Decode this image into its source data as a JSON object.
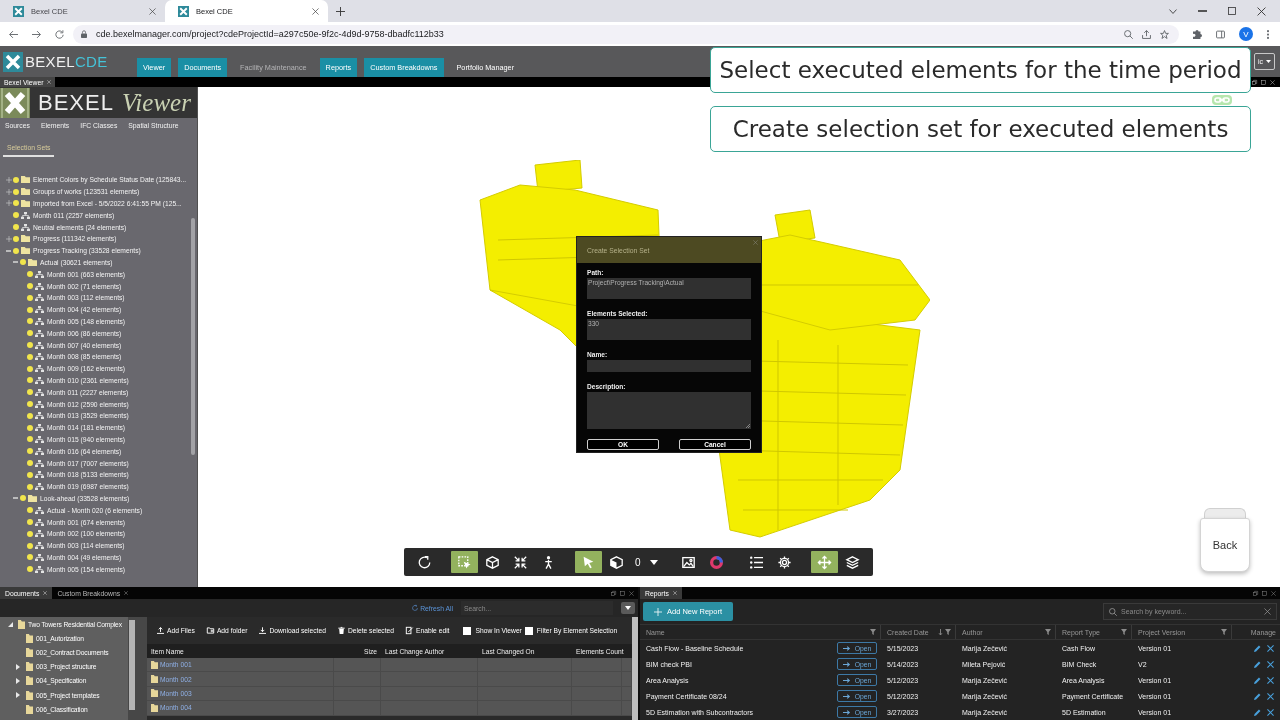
{
  "browser": {
    "tabs": [
      {
        "title": "Bexel CDE",
        "selected": false
      },
      {
        "title": "Bexel CDE",
        "selected": true
      }
    ],
    "url": "cde.bexelmanager.com/project?cdeProjectId=a297c50e-9f2c-4d9d-9758-dbadfc112b33",
    "profile": "V"
  },
  "app_header": {
    "logo": {
      "brand": "BEXEL",
      "product": "CDE"
    },
    "nav": [
      {
        "label": "Viewer",
        "open": true,
        "disabled": false
      },
      {
        "label": "Documents",
        "open": true,
        "disabled": false
      },
      {
        "label": "Facility Maintenance",
        "open": false,
        "disabled": true
      },
      {
        "label": "Reports",
        "open": true,
        "disabled": false
      },
      {
        "label": "Custom Breakdowns",
        "open": true,
        "disabled": false
      },
      {
        "label": "Portfolio Manager",
        "open": false,
        "disabled": false
      }
    ],
    "dropdown": "ic"
  },
  "viewer_panel": {
    "tab": "Bexel Viewer",
    "sidebar": {
      "logo": {
        "brand": "BEXEL",
        "product": "Viewer"
      },
      "tabs": [
        {
          "label": "Sources",
          "selected": false
        },
        {
          "label": "Elements",
          "selected": false
        },
        {
          "label": "IFC Classes",
          "selected": false
        },
        {
          "label": "Spatial Structure",
          "selected": false
        },
        {
          "label": "Selection Sets",
          "selected": true
        }
      ],
      "tree": [
        {
          "label": "Element Colors by Schedule Status Date (125843...",
          "kind": "folder",
          "expanded": false
        },
        {
          "label": "Groups of works (123531 elements)",
          "kind": "folder",
          "expanded": false
        },
        {
          "label": "Imported from Excel - 5/5/2022 6:41:55 PM (125...",
          "kind": "folder",
          "expanded": false
        },
        {
          "label": "Month 011 (2257 elements)",
          "kind": "set"
        },
        {
          "label": "Neutral elements (24 elements)",
          "kind": "set"
        },
        {
          "label": "Progress (111342 elements)",
          "kind": "folder",
          "expanded": false
        },
        {
          "label": "Progress Tracking (33528 elements)",
          "kind": "folder",
          "expanded": true,
          "children": [
            {
              "label": "Actual (30621 elements)",
              "kind": "folder",
              "expanded": true,
              "children": [
                {
                  "label": "Month 001 (663 elements)",
                  "kind": "set"
                },
                {
                  "label": "Month 002 (71 elements)",
                  "kind": "set"
                },
                {
                  "label": "Month 003 (112 elements)",
                  "kind": "set"
                },
                {
                  "label": "Month 004 (42 elements)",
                  "kind": "set"
                },
                {
                  "label": "Month 005 (148 elements)",
                  "kind": "set"
                },
                {
                  "label": "Month 006 (86 elements)",
                  "kind": "set"
                },
                {
                  "label": "Month 007 (40 elements)",
                  "kind": "set"
                },
                {
                  "label": "Month 008 (85 elements)",
                  "kind": "set"
                },
                {
                  "label": "Month 009 (162 elements)",
                  "kind": "set"
                },
                {
                  "label": "Month 010 (2361 elements)",
                  "kind": "set"
                },
                {
                  "label": "Month 011 (2227 elements)",
                  "kind": "set"
                },
                {
                  "label": "Month 012 (2590 elements)",
                  "kind": "set"
                },
                {
                  "label": "Month 013 (3529 elements)",
                  "kind": "set"
                },
                {
                  "label": "Month 014 (181 elements)",
                  "kind": "set"
                },
                {
                  "label": "Month 015 (940 elements)",
                  "kind": "set"
                },
                {
                  "label": "Month 016 (64 elements)",
                  "kind": "set"
                },
                {
                  "label": "Month 017 (7007 elements)",
                  "kind": "set"
                },
                {
                  "label": "Month 018 (5133 elements)",
                  "kind": "set"
                },
                {
                  "label": "Month 019 (6987 elements)",
                  "kind": "set"
                }
              ]
            },
            {
              "label": "Look-ahead (33528 elements)",
              "kind": "folder",
              "expanded": true,
              "children": [
                {
                  "label": "Actual - Month 020 (6 elements)",
                  "kind": "set"
                },
                {
                  "label": "Month 001 (674 elements)",
                  "kind": "set"
                },
                {
                  "label": "Month 002 (100 elements)",
                  "kind": "set"
                },
                {
                  "label": "Month 003 (114 elements)",
                  "kind": "set"
                },
                {
                  "label": "Month 004 (49 elements)",
                  "kind": "set"
                },
                {
                  "label": "Month 005 (154 elements)",
                  "kind": "set"
                }
              ]
            }
          ]
        }
      ]
    },
    "toolbar": {
      "groups": [
        [
          {
            "kind": "button",
            "selected": false
          }
        ],
        [
          {
            "kind": "button",
            "selected": true
          },
          {
            "kind": "button",
            "selected": false
          },
          {
            "kind": "button",
            "selected": false
          },
          {
            "kind": "button",
            "selected": false
          }
        ],
        [
          {
            "kind": "button",
            "selected": true
          },
          {
            "kind": "button",
            "selected": false
          },
          {
            "kind": "counter",
            "value": "0"
          }
        ],
        [
          {
            "kind": "button",
            "selected": false
          },
          {
            "kind": "button",
            "selected": false
          }
        ],
        [
          {
            "kind": "button",
            "selected": false
          },
          {
            "kind": "button",
            "selected": false
          }
        ],
        [
          {
            "kind": "button",
            "selected": true
          },
          {
            "kind": "button",
            "selected": false
          }
        ]
      ]
    },
    "nav_cube": {
      "face": "Back"
    },
    "dialog": {
      "title": "Create Selection Set",
      "fields": [
        {
          "label": "Path:",
          "kind": "readonly",
          "value": "Project\\Progress Tracking\\Actual"
        },
        {
          "label": "Elements Selected:",
          "kind": "readonly",
          "value": "330"
        },
        {
          "label": "Name:",
          "kind": "input"
        },
        {
          "label": "Description:",
          "kind": "textarea"
        }
      ],
      "buttons": [
        "OK",
        "Cancel"
      ]
    }
  },
  "callouts": [
    "Select executed elements for the time period",
    "Create selection set for executed elements"
  ],
  "documents_panel": {
    "tabs": [
      {
        "label": "Documents",
        "selected": true
      },
      {
        "label": "Custom Breakdowns",
        "selected": false
      }
    ],
    "refresh": "Refresh All",
    "search": {
      "placeholder": "Search..."
    },
    "folders": [
      {
        "label": "Two Towers Residential Complex",
        "expanded": true,
        "children": [
          {
            "label": "001_Autorization"
          },
          {
            "label": "002_Contract Documents"
          },
          {
            "label": "003_Project structure",
            "expanded": false
          },
          {
            "label": "004_Specification",
            "expanded": false
          },
          {
            "label": "005_Project templates",
            "expanded": false
          },
          {
            "label": "006_Classification"
          }
        ]
      }
    ],
    "actions": [
      "Add Files",
      "Add folder",
      "Download selected",
      "Delete selected",
      "Enable edit"
    ],
    "checkboxes": [
      {
        "label": "Show In Viewer",
        "checked": false
      },
      {
        "label": "Filter By Element Selection",
        "checked": false
      }
    ],
    "columns": [
      "Item Name",
      "Size",
      "Last Change Author",
      "Last Changed On",
      "Elements Count"
    ],
    "rows": [
      {
        "name": "Month 001"
      },
      {
        "name": "Month 002"
      },
      {
        "name": "Month 003"
      },
      {
        "name": "Month 004"
      }
    ]
  },
  "reports_panel": {
    "tab": "Reports",
    "add_button": "Add New Report",
    "search": {
      "placeholder": "Search by keyword..."
    },
    "columns": [
      {
        "label": "Name",
        "filter": true,
        "sorted": false
      },
      {
        "label": "Created Date",
        "filter": true,
        "sorted": true
      },
      {
        "label": "Author",
        "filter": true,
        "sorted": false
      },
      {
        "label": "Report Type",
        "filter": true,
        "sorted": false
      },
      {
        "label": "Project Version",
        "filter": true,
        "sorted": false
      },
      {
        "label": "Manage",
        "filter": false,
        "sorted": false
      }
    ],
    "rows": [
      {
        "name": "Cash Flow - Baseline Schedule",
        "action": "Open",
        "created": "5/15/2023",
        "author": "Marija Zečević",
        "type": "Cash Flow",
        "version": "Version 01"
      },
      {
        "name": "BIM check PBI",
        "action": "Open",
        "created": "5/14/2023",
        "author": "Mileta Pejović",
        "type": "BIM Check",
        "version": "V2"
      },
      {
        "name": "Area Analysis",
        "action": "Open",
        "created": "5/12/2023",
        "author": "Marija Zečević",
        "type": "Area Analysis",
        "version": "Version 01"
      },
      {
        "name": "Payment Certificate 08/24",
        "action": "Open",
        "created": "5/12/2023",
        "author": "Marija Zečević",
        "type": "Payment Certificate",
        "version": "Version 01"
      },
      {
        "name": "5D Estimation with Subcontractors",
        "action": "Open",
        "created": "3/27/2023",
        "author": "Marija Zečević",
        "type": "5D Estimation",
        "version": "Version 01"
      }
    ]
  }
}
